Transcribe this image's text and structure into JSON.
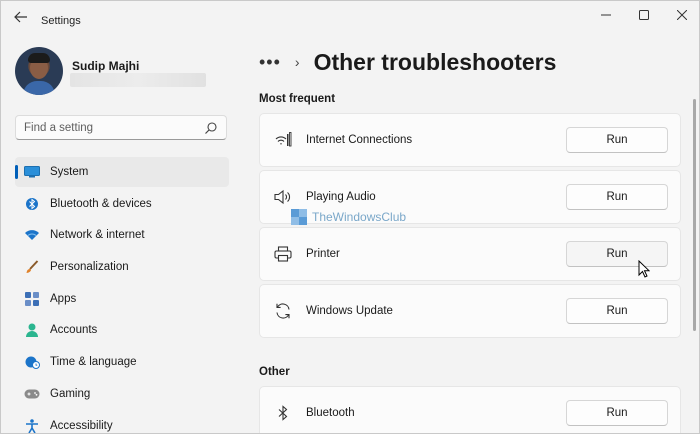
{
  "window": {
    "title": "Settings",
    "controls": {
      "minimize": "—",
      "maximize": "☐",
      "close": "✕"
    }
  },
  "profile": {
    "name": "Sudip Majhi"
  },
  "search": {
    "placeholder": "Find a setting"
  },
  "sidebar": {
    "items": [
      {
        "label": "System",
        "icon": "monitor-icon",
        "active": true
      },
      {
        "label": "Bluetooth & devices",
        "icon": "bluetooth-icon"
      },
      {
        "label": "Network & internet",
        "icon": "wifi-icon"
      },
      {
        "label": "Personalization",
        "icon": "brush-icon"
      },
      {
        "label": "Apps",
        "icon": "apps-icon"
      },
      {
        "label": "Accounts",
        "icon": "person-icon"
      },
      {
        "label": "Time & language",
        "icon": "globe-clock-icon"
      },
      {
        "label": "Gaming",
        "icon": "gamepad-icon"
      },
      {
        "label": "Accessibility",
        "icon": "accessibility-icon"
      }
    ]
  },
  "breadcrumb": {
    "more": "•••",
    "chevron": "›"
  },
  "main": {
    "title": "Other troubleshooters",
    "sections": [
      {
        "label": "Most frequent",
        "items": [
          {
            "label": "Internet Connections",
            "icon": "network-signal-icon",
            "button": "Run"
          },
          {
            "label": "Playing Audio",
            "icon": "speaker-icon",
            "button": "Run"
          },
          {
            "label": "Printer",
            "icon": "printer-icon",
            "button": "Run"
          },
          {
            "label": "Windows Update",
            "icon": "sync-icon",
            "button": "Run"
          }
        ]
      },
      {
        "label": "Other",
        "items": [
          {
            "label": "Bluetooth",
            "icon": "bluetooth-icon",
            "button": "Run"
          }
        ]
      }
    ]
  },
  "watermark": {
    "text": "TheWindowsClub"
  },
  "colors": {
    "accent": "#005fb8",
    "background": "#f3f3f3",
    "card": "#fbfbfb"
  }
}
